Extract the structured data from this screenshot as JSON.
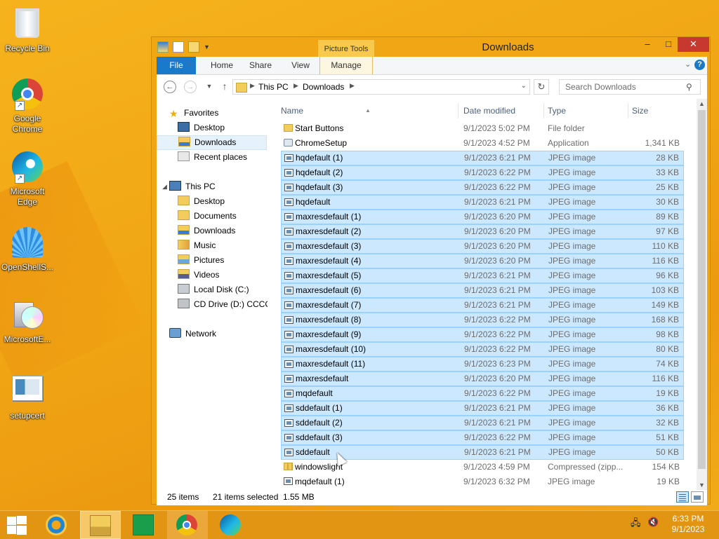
{
  "desktop": {
    "icons": [
      {
        "label": "Recycle Bin",
        "icon": "recycle-bin-icon"
      },
      {
        "label": "Google Chrome",
        "icon": "chrome-icon"
      },
      {
        "label": "Microsoft Edge",
        "icon": "edge-icon"
      },
      {
        "label": "OpenShellS...",
        "icon": "open-shell-icon"
      },
      {
        "label": "MicrosoftE...",
        "icon": "installer-disc-icon"
      },
      {
        "label": "setupcert",
        "icon": "certificate-icon"
      }
    ]
  },
  "window": {
    "title": "Downloads",
    "context_tab": "Picture Tools",
    "controls": {
      "minimize": "–",
      "maximize": "□",
      "close": "✕"
    },
    "ribbon_tabs": [
      "File",
      "Home",
      "Share",
      "View",
      "Manage"
    ],
    "help": "?"
  },
  "address": {
    "segments": [
      "This PC",
      "Downloads"
    ],
    "search_placeholder": "Search Downloads"
  },
  "nav": {
    "favorites_label": "Favorites",
    "favorites": [
      "Desktop",
      "Downloads",
      "Recent places"
    ],
    "thispc_label": "This PC",
    "thispc": [
      "Desktop",
      "Documents",
      "Downloads",
      "Music",
      "Pictures",
      "Videos",
      "Local Disk (C:)",
      "CD Drive (D:) CCCOI"
    ],
    "network_label": "Network",
    "selected": "Downloads"
  },
  "columns": {
    "name": "Name",
    "date": "Date modified",
    "type": "Type",
    "size": "Size"
  },
  "files": [
    {
      "name": "Start Buttons",
      "date": "9/1/2023 5:02 PM",
      "type": "File folder",
      "size": "",
      "kind": "folder",
      "selected": false
    },
    {
      "name": "ChromeSetup",
      "date": "9/1/2023 4:52 PM",
      "type": "Application",
      "size": "1,341 KB",
      "kind": "app",
      "selected": false
    },
    {
      "name": "hqdefault (1)",
      "date": "9/1/2023 6:21 PM",
      "type": "JPEG image",
      "size": "28 KB",
      "kind": "jpg",
      "selected": true
    },
    {
      "name": "hqdefault (2)",
      "date": "9/1/2023 6:22 PM",
      "type": "JPEG image",
      "size": "33 KB",
      "kind": "jpg",
      "selected": true
    },
    {
      "name": "hqdefault (3)",
      "date": "9/1/2023 6:22 PM",
      "type": "JPEG image",
      "size": "25 KB",
      "kind": "jpg",
      "selected": true
    },
    {
      "name": "hqdefault",
      "date": "9/1/2023 6:21 PM",
      "type": "JPEG image",
      "size": "30 KB",
      "kind": "jpg",
      "selected": true
    },
    {
      "name": "maxresdefault (1)",
      "date": "9/1/2023 6:20 PM",
      "type": "JPEG image",
      "size": "89 KB",
      "kind": "jpg",
      "selected": true
    },
    {
      "name": "maxresdefault (2)",
      "date": "9/1/2023 6:20 PM",
      "type": "JPEG image",
      "size": "97 KB",
      "kind": "jpg",
      "selected": true
    },
    {
      "name": "maxresdefault (3)",
      "date": "9/1/2023 6:20 PM",
      "type": "JPEG image",
      "size": "110 KB",
      "kind": "jpg",
      "selected": true
    },
    {
      "name": "maxresdefault (4)",
      "date": "9/1/2023 6:20 PM",
      "type": "JPEG image",
      "size": "116 KB",
      "kind": "jpg",
      "selected": true
    },
    {
      "name": "maxresdefault (5)",
      "date": "9/1/2023 6:21 PM",
      "type": "JPEG image",
      "size": "96 KB",
      "kind": "jpg",
      "selected": true
    },
    {
      "name": "maxresdefault (6)",
      "date": "9/1/2023 6:21 PM",
      "type": "JPEG image",
      "size": "103 KB",
      "kind": "jpg",
      "selected": true
    },
    {
      "name": "maxresdefault (7)",
      "date": "9/1/2023 6:21 PM",
      "type": "JPEG image",
      "size": "149 KB",
      "kind": "jpg",
      "selected": true
    },
    {
      "name": "maxresdefault (8)",
      "date": "9/1/2023 6:22 PM",
      "type": "JPEG image",
      "size": "168 KB",
      "kind": "jpg",
      "selected": true
    },
    {
      "name": "maxresdefault (9)",
      "date": "9/1/2023 6:22 PM",
      "type": "JPEG image",
      "size": "98 KB",
      "kind": "jpg",
      "selected": true
    },
    {
      "name": "maxresdefault (10)",
      "date": "9/1/2023 6:22 PM",
      "type": "JPEG image",
      "size": "80 KB",
      "kind": "jpg",
      "selected": true
    },
    {
      "name": "maxresdefault (11)",
      "date": "9/1/2023 6:23 PM",
      "type": "JPEG image",
      "size": "74 KB",
      "kind": "jpg",
      "selected": true
    },
    {
      "name": "maxresdefault",
      "date": "9/1/2023 6:20 PM",
      "type": "JPEG image",
      "size": "116 KB",
      "kind": "jpg",
      "selected": true
    },
    {
      "name": "mqdefault",
      "date": "9/1/2023 6:22 PM",
      "type": "JPEG image",
      "size": "19 KB",
      "kind": "jpg",
      "selected": true
    },
    {
      "name": "sddefault (1)",
      "date": "9/1/2023 6:21 PM",
      "type": "JPEG image",
      "size": "36 KB",
      "kind": "jpg",
      "selected": true
    },
    {
      "name": "sddefault (2)",
      "date": "9/1/2023 6:21 PM",
      "type": "JPEG image",
      "size": "32 KB",
      "kind": "jpg",
      "selected": true
    },
    {
      "name": "sddefault (3)",
      "date": "9/1/2023 6:22 PM",
      "type": "JPEG image",
      "size": "51 KB",
      "kind": "jpg",
      "selected": true
    },
    {
      "name": "sddefault",
      "date": "9/1/2023 6:21 PM",
      "type": "JPEG image",
      "size": "50 KB",
      "kind": "jpg",
      "selected": true
    },
    {
      "name": "windowslight",
      "date": "9/1/2023 4:59 PM",
      "type": "Compressed (zipp...",
      "size": "154 KB",
      "kind": "zip",
      "selected": false
    },
    {
      "name": "mqdefault (1)",
      "date": "9/1/2023 6:32 PM",
      "type": "JPEG image",
      "size": "19 KB",
      "kind": "jpg",
      "selected": false
    }
  ],
  "status": {
    "items": "25 items",
    "selected": "21 items selected",
    "size": "1.55 MB"
  },
  "taskbar": {
    "apps": [
      "internet-explorer-icon",
      "file-explorer-icon",
      "store-icon",
      "chrome-icon",
      "edge-icon"
    ],
    "time": "6:33 PM",
    "date": "9/1/2023"
  },
  "colors": {
    "selection": "#cce8ff",
    "selection_border": "#99d1ff",
    "file_tab": "#1979ca",
    "close": "#c7382e"
  }
}
